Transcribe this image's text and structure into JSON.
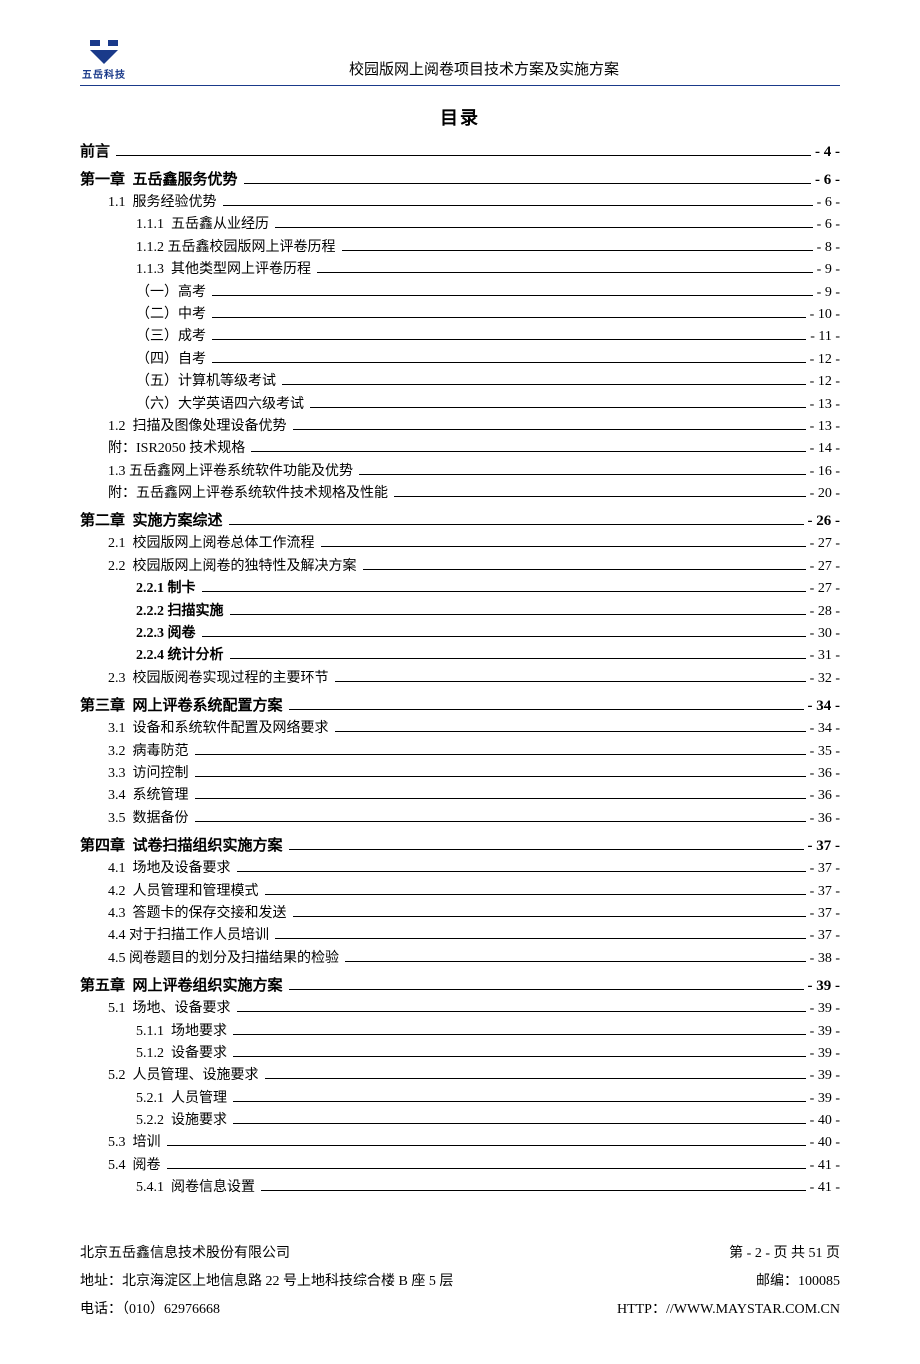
{
  "header": {
    "logo_text": "五岳科技",
    "doc_title": "校园版网上阅卷项目技术方案及实施方案"
  },
  "toc_title": "目录",
  "toc": [
    {
      "level": 0,
      "label": "前言",
      "page": "- 4 -"
    },
    {
      "level": 0,
      "label": "第一章  五岳鑫服务优势",
      "page": "- 6 -"
    },
    {
      "level": 1,
      "label": "1.1  服务经验优势",
      "page": "- 6 -"
    },
    {
      "level": 2,
      "label": "1.1.1  五岳鑫从业经历",
      "page": "- 6 -"
    },
    {
      "level": 2,
      "label": "1.1.2 五岳鑫校园版网上评卷历程",
      "page": "- 8 -"
    },
    {
      "level": 2,
      "label": "1.1.3  其他类型网上评卷历程",
      "page": "- 9 -"
    },
    {
      "level": 2,
      "label": "（一）高考",
      "page": "- 9 -"
    },
    {
      "level": 2,
      "label": "（二）中考",
      "page": "- 10 -"
    },
    {
      "level": 2,
      "label": "（三）成考",
      "page": "- 11 -"
    },
    {
      "level": 2,
      "label": "（四）自考",
      "page": "- 12 -"
    },
    {
      "level": 2,
      "label": "（五）计算机等级考试",
      "page": "- 12 -"
    },
    {
      "level": 2,
      "label": "（六）大学英语四六级考试",
      "page": "- 13 -"
    },
    {
      "level": 1,
      "label": "1.2  扫描及图像处理设备优势",
      "page": "- 13 -"
    },
    {
      "level": 1,
      "label": "附：ISR2050 技术规格",
      "page": "- 14 -"
    },
    {
      "level": 1,
      "label": "1.3 五岳鑫网上评卷系统软件功能及优势",
      "page": "- 16 -"
    },
    {
      "level": 1,
      "label": "附：五岳鑫网上评卷系统软件技术规格及性能",
      "page": "- 20 -"
    },
    {
      "level": 0,
      "label": "第二章  实施方案综述",
      "page": "- 26 -"
    },
    {
      "level": 1,
      "label": "2.1  校园版网上阅卷总体工作流程",
      "page": "- 27 -"
    },
    {
      "level": 1,
      "label": "2.2  校园版网上阅卷的独特性及解决方案",
      "page": "- 27 -"
    },
    {
      "level": 2,
      "bold": true,
      "label": "2.2.1 制卡",
      "page": "- 27 -"
    },
    {
      "level": 2,
      "bold": true,
      "label": "2.2.2 扫描实施",
      "page": "- 28 -"
    },
    {
      "level": 2,
      "bold": true,
      "label": "2.2.3 阅卷",
      "page": "- 30 -"
    },
    {
      "level": 2,
      "bold": true,
      "label": "2.2.4 统计分析",
      "page": "- 31 -"
    },
    {
      "level": 1,
      "label": "2.3  校园版阅卷实现过程的主要环节",
      "page": "- 32 -"
    },
    {
      "level": 0,
      "label": "第三章  网上评卷系统配置方案",
      "page": "- 34 -"
    },
    {
      "level": 1,
      "label": "3.1  设备和系统软件配置及网络要求",
      "page": "- 34 -"
    },
    {
      "level": 1,
      "label": "3.2  病毒防范",
      "page": "- 35 -"
    },
    {
      "level": 1,
      "label": "3.3  访问控制",
      "page": "- 36 -"
    },
    {
      "level": 1,
      "label": "3.4  系统管理",
      "page": "- 36 -"
    },
    {
      "level": 1,
      "label": "3.5  数据备份",
      "page": "- 36 -"
    },
    {
      "level": 0,
      "label": "第四章  试卷扫描组织实施方案",
      "page": "- 37 -"
    },
    {
      "level": 1,
      "label": "4.1  场地及设备要求",
      "page": "- 37 -"
    },
    {
      "level": 1,
      "label": "4.2  人员管理和管理模式",
      "page": "- 37 -"
    },
    {
      "level": 1,
      "label": "4.3  答题卡的保存交接和发送",
      "page": "- 37 -"
    },
    {
      "level": 1,
      "label": "4.4 对于扫描工作人员培训",
      "page": "- 37 -"
    },
    {
      "level": 1,
      "label": "4.5 阅卷题目的划分及扫描结果的检验",
      "page": "- 38 -"
    },
    {
      "level": 0,
      "label": "第五章  网上评卷组织实施方案",
      "page": "- 39 -"
    },
    {
      "level": 1,
      "label": "5.1  场地、设备要求",
      "page": "- 39 -"
    },
    {
      "level": 2,
      "label": "5.1.1  场地要求",
      "page": "- 39 -"
    },
    {
      "level": 2,
      "label": "5.1.2  设备要求",
      "page": "- 39 -"
    },
    {
      "level": 1,
      "label": "5.2  人员管理、设施要求",
      "page": "- 39 -"
    },
    {
      "level": 2,
      "label": "5.2.1  人员管理",
      "page": "- 39 -"
    },
    {
      "level": 2,
      "label": "5.2.2  设施要求",
      "page": "- 40 -"
    },
    {
      "level": 1,
      "label": "5.3  培训",
      "page": "- 40 -"
    },
    {
      "level": 1,
      "label": "5.4  阅卷",
      "page": "- 41 -"
    },
    {
      "level": 2,
      "label": "5.4.1  阅卷信息设置",
      "page": "- 41 -"
    }
  ],
  "footer": {
    "company": "北京五岳鑫信息技术股份有限公司",
    "page_info": "第  - 2 -  页 共  51  页",
    "address": "地址：北京海淀区上地信息路 22 号上地科技综合楼 B 座 5 层",
    "postcode": "邮编：100085",
    "phone": "电话：（010）62976668",
    "website": "HTTP：//WWW.MAYSTAR.COM.CN"
  }
}
